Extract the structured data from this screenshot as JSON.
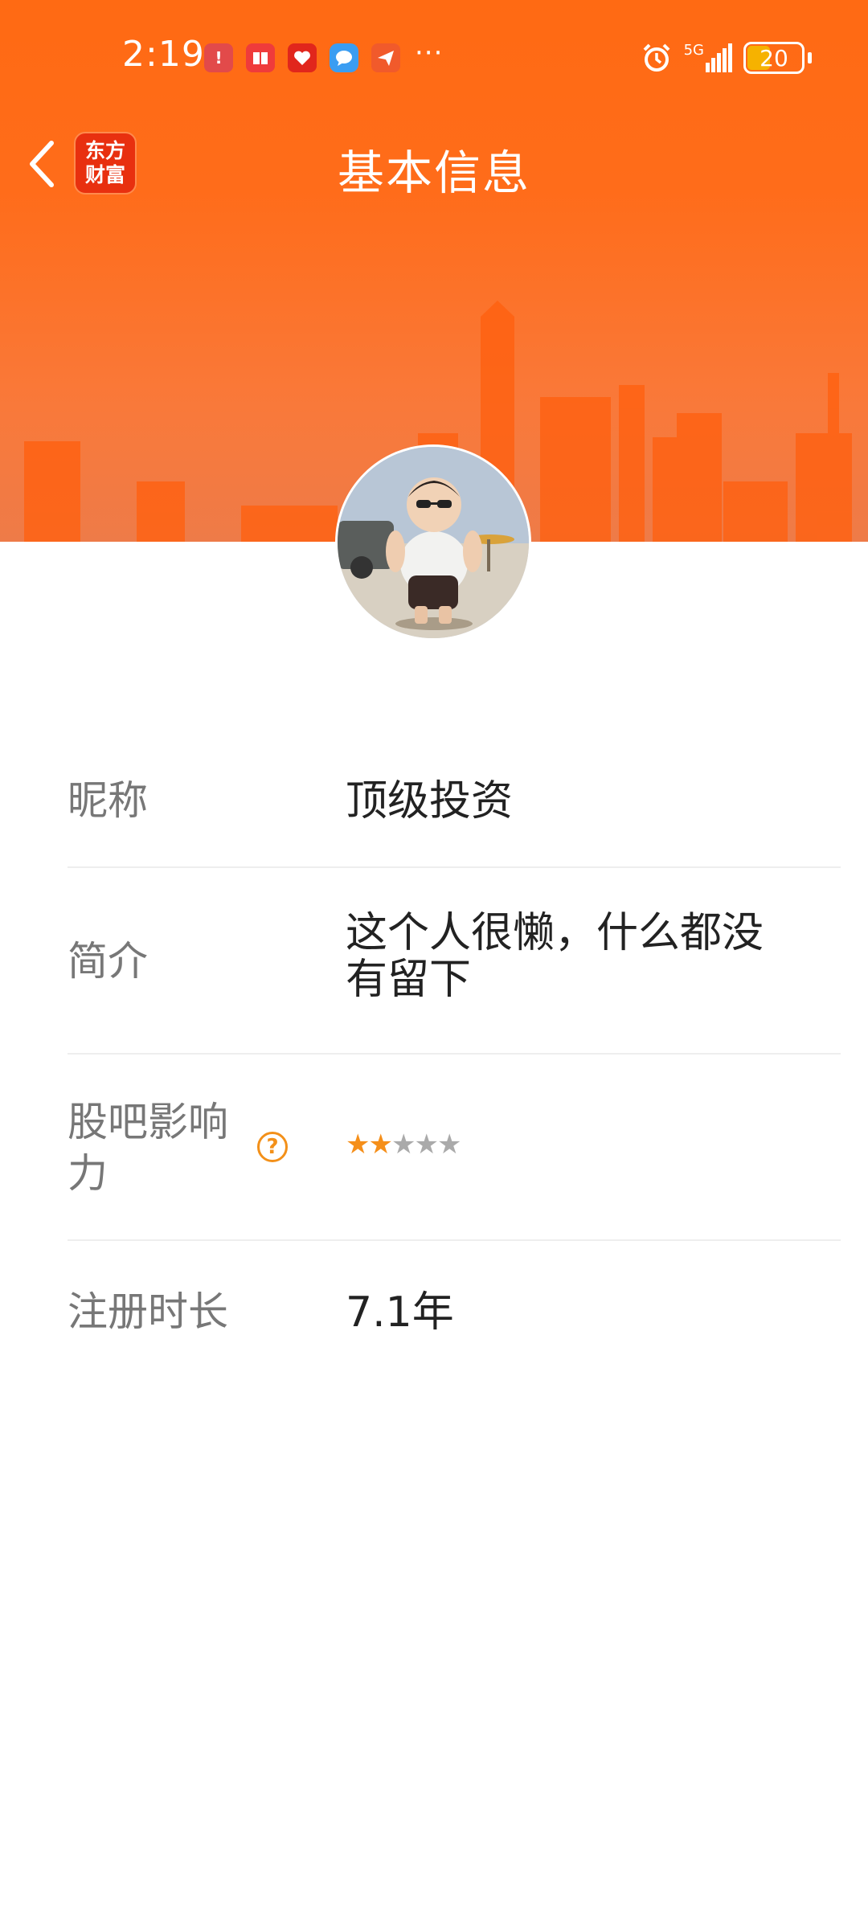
{
  "status_bar": {
    "time": "2:19",
    "more_indicator": "···",
    "network": "5G",
    "battery_level": "20",
    "notification_icons": [
      "app-notification-icon",
      "book-icon",
      "heart-icon",
      "message-icon",
      "send-icon"
    ],
    "right_icons": [
      "alarm-icon",
      "signal-icon",
      "battery-icon"
    ]
  },
  "nav": {
    "title": "基本信息",
    "logo_line1": "东方",
    "logo_line2": "财富"
  },
  "profile": {
    "avatar": "user-avatar"
  },
  "info_rows": [
    {
      "label": "昵称",
      "value": "顶级投资"
    },
    {
      "label": "简介",
      "value": "这个人很懒，什么都没有留下"
    },
    {
      "label": "股吧影响力",
      "help": "?",
      "rating": 2,
      "rating_max": 5
    },
    {
      "label": "注册时长",
      "value": "7.1年"
    }
  ],
  "colors": {
    "header": "#ff6a13",
    "accent": "#f58f1a",
    "logo": "#e8300f"
  }
}
